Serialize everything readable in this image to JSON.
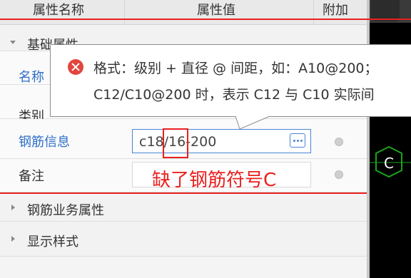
{
  "header": {
    "col_name": "属性名称",
    "col_value": "属性值",
    "col_extra": "附加"
  },
  "groups": {
    "basic": "基础属性",
    "business": "钢筋业务属性",
    "display": "显示样式"
  },
  "rows": {
    "name_label": "名称",
    "type_label": "类别",
    "rebar_label": "钢筋信息",
    "rebar_value": "c18/16-200",
    "note_label": "备注",
    "note_value": ""
  },
  "tooltip": {
    "line1": "格式：级别 + 直径 @ 间距，如：A10@200；",
    "line2": "C12/C10@200 时，表示 C12 与 C10 实际间"
  },
  "annotation": {
    "text": "缺了钢筋符号C"
  },
  "canvas": {
    "marker_letter": "C"
  },
  "colors": {
    "annotation_red": "#e8201e",
    "link_blue": "#2f6fc9",
    "error_red": "#e2453d",
    "marker_green": "#1aa31a"
  }
}
